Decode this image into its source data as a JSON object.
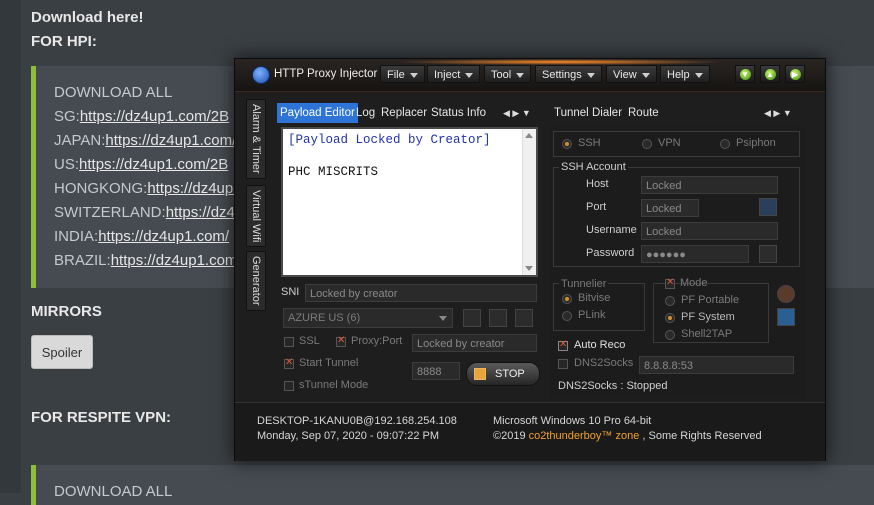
{
  "forum": {
    "download_here": "Download here!",
    "for_hpi": "FOR HPI:",
    "download_all": "DOWNLOAD ALL",
    "links": [
      {
        "label": "SG:",
        "url": "https://dz4up1.com/2B"
      },
      {
        "label": "JAPAN:",
        "url": "https://dz4up1.com/2B"
      },
      {
        "label": "US:",
        "url": "https://dz4up1.com/2B"
      },
      {
        "label": "HONGKONG:",
        "url": "https://dz4up1"
      },
      {
        "label": "SWITZERLAND:",
        "url": "https://dz4u"
      },
      {
        "label": "INDIA:",
        "url": "https://dz4up1.com/"
      },
      {
        "label": "BRAZIL:",
        "url": "https://dz4up1.com"
      }
    ],
    "mirrors": "MIRRORS",
    "spoiler": "Spoiler",
    "for_respite": "FOR RESPITE VPN:",
    "download_all_2": "DOWNLOAD ALL"
  },
  "app": {
    "title": "HTTP Proxy Injector",
    "menus": [
      "File",
      "Inject",
      "Tool",
      "Settings",
      "View",
      "Help"
    ],
    "side_tabs": [
      "Alarm & Timer",
      "Virtual Wifi",
      "Generator"
    ],
    "left_tabs": [
      "Payload Editor",
      "Log",
      "Replacer",
      "Status Info"
    ],
    "right_tabs": [
      "Tunnel",
      "Dialer",
      "Route"
    ],
    "payload_line1": "[Payload Locked by Creator]",
    "payload_line2": "PHC MISCRITS",
    "sni_label": "SNI",
    "sni_value": "Locked by creator",
    "server": "AZURE US (6)",
    "ssl_label": "SSL",
    "proxy_port_label": "Proxy:Port",
    "proxy_value": "Locked by creator",
    "start_tunnel": "Start Tunnel",
    "stunnel_mode": "sTunnel Mode",
    "port_value": "8888",
    "stop": "STOP",
    "protocols": [
      "SSH",
      "VPN",
      "Psiphon"
    ],
    "ssh_account": "SSH Account",
    "ssh_fields": [
      {
        "label": "Host",
        "value": "Locked"
      },
      {
        "label": "Port",
        "value": "Locked"
      },
      {
        "label": "Username",
        "value": "Locked"
      },
      {
        "label": "Password",
        "value": "●●●●●●"
      }
    ],
    "tunnelier": "Tunnelier",
    "tunnelier_opts": [
      "Bitvise",
      "PLink"
    ],
    "mode": "Mode",
    "mode_opts": [
      "PF Portable",
      "PF System",
      "Shell2TAP"
    ],
    "auto_reco": "Auto Reco",
    "dns2socks": "DNS2Socks",
    "dns_value": "8.8.8.8:53",
    "dns_status": "DNS2Socks : Stopped",
    "footer_host": "DESKTOP-1KANU0B@192.168.254.108",
    "footer_date": "Monday, Sep 07, 2020 - 09:07:22 PM",
    "footer_os": "Microsoft Windows 10 Pro 64-bit",
    "footer_copy_prefix": "©2019 ",
    "footer_author": "co2thunderboy™ zone",
    "footer_copy_suffix": " , Some Rights Reserved"
  }
}
